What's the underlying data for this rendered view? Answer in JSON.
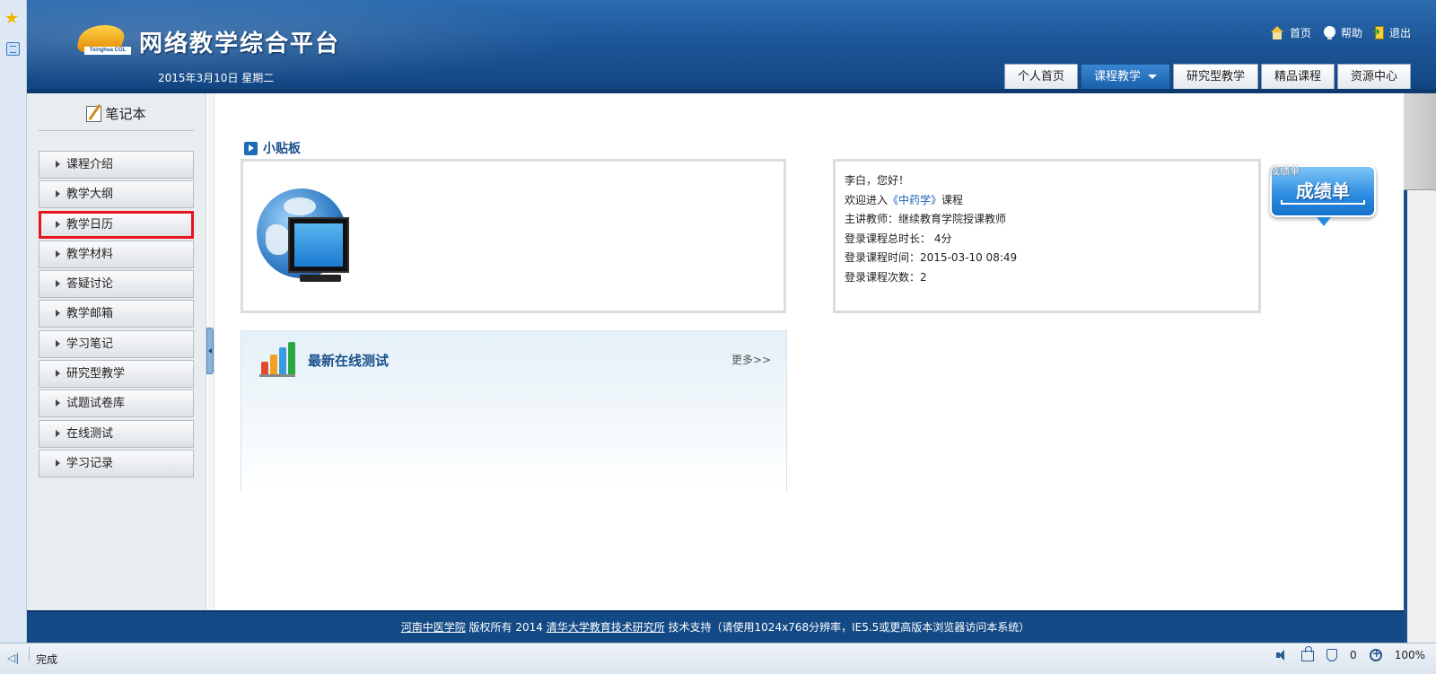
{
  "header": {
    "site_title": "网络教学综合平台",
    "logo_tag": "Tsinghua COL",
    "date": "2015年3月10日 星期二",
    "top_links": [
      {
        "label": "首页",
        "icon": "home-icon"
      },
      {
        "label": "帮助",
        "icon": "help-icon"
      },
      {
        "label": "退出",
        "icon": "exit-icon"
      }
    ],
    "nav_tabs": [
      {
        "label": "个人首页",
        "active": false
      },
      {
        "label": "课程教学",
        "active": true
      },
      {
        "label": "研究型教学",
        "active": false
      },
      {
        "label": "精品课程",
        "active": false
      },
      {
        "label": "资源中心",
        "active": false
      }
    ]
  },
  "sidebar": {
    "notebook_label": "笔记本",
    "items": [
      {
        "label": "课程介绍"
      },
      {
        "label": "教学大纲"
      },
      {
        "label": "教学日历",
        "highlighted": true
      },
      {
        "label": "教学材料"
      },
      {
        "label": "答疑讨论"
      },
      {
        "label": "教学邮箱"
      },
      {
        "label": "学习笔记"
      },
      {
        "label": "研究型教学"
      },
      {
        "label": "试题试卷库"
      },
      {
        "label": "在线测试"
      },
      {
        "label": "学习记录"
      }
    ]
  },
  "main": {
    "board_title": "小贴板",
    "welcome": {
      "greeting": "李白，您好！",
      "enter_prefix": "欢迎进入",
      "course_name": "《中药学》",
      "enter_suffix": "课程",
      "teacher": "主讲教师：继续教育学院授课教师",
      "total_duration": "登录课程总时长： 4分",
      "login_time": "登录课程时间：2015-03-10 08:49",
      "login_count": "登录课程次数：2"
    },
    "grade_badge": {
      "small_label": "成绩单",
      "label": "成绩单"
    },
    "online_test": {
      "title": "最新在线测试",
      "more": "更多>>"
    }
  },
  "footer": {
    "org": "河南中医学院",
    "copyright": " 版权所有 2014 ",
    "tech_org": "清华大学教育技术研究所",
    "tech_suffix": " 技术支持（请使用1024x768分辨率，IE5.5或更高版本浏览器访问本系统）"
  },
  "statusbar": {
    "back_icon": "◁|",
    "status": "完成",
    "blocked_count": "0",
    "zoom": "100%"
  }
}
